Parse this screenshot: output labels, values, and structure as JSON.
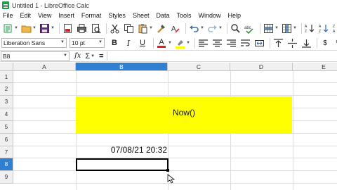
{
  "window": {
    "title": "Untitled 1 - LibreOffice Calc"
  },
  "menu": [
    "File",
    "Edit",
    "View",
    "Insert",
    "Format",
    "Styles",
    "Sheet",
    "Data",
    "Tools",
    "Window",
    "Help"
  ],
  "format_toolbar": {
    "font_name": "Liberation Sans",
    "font_size": "10 pt",
    "bold": "B",
    "italic": "I",
    "underline": "U",
    "font_color_glyph": "A",
    "currency": "$",
    "percent": "%"
  },
  "formula_bar": {
    "cell_ref": "B8",
    "fx": "fx",
    "sum": "Σ",
    "equals": "="
  },
  "columns": [
    "A",
    "B",
    "C",
    "D",
    "E"
  ],
  "rows": [
    "1",
    "2",
    "3",
    "4",
    "5",
    "6",
    "7",
    "8",
    "9"
  ],
  "active": {
    "column": "B",
    "row": "8"
  },
  "cells": {
    "B4_D5": "Now()",
    "B7": "07/08/21 20:32"
  },
  "colors": {
    "highlight_fill": "#ffff00",
    "header_active": "#2f7fd2",
    "font_color_bar": "#e02020",
    "highlight_bar": "#ffff00"
  }
}
